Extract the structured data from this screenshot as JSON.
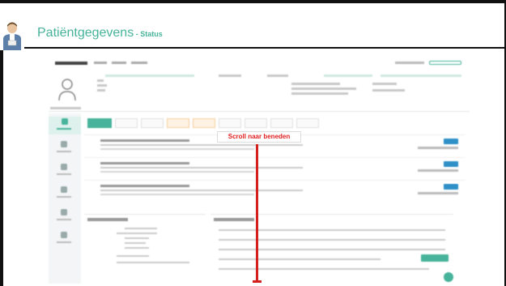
{
  "slide": {
    "title": "Patiëntgegevens",
    "separator": " - ",
    "subtitle": "Status"
  },
  "annotation": {
    "scroll_label": "Scroll naar beneden"
  },
  "colors": {
    "accent": "#46b39a",
    "arrow": "#d41f1f",
    "label_text": "#e02020",
    "action_blue": "#2f8fc7"
  },
  "icons": {
    "presenter": "person-avatar-icon",
    "patient": "patient-avatar-icon",
    "scroll": "arrow-down-icon"
  }
}
